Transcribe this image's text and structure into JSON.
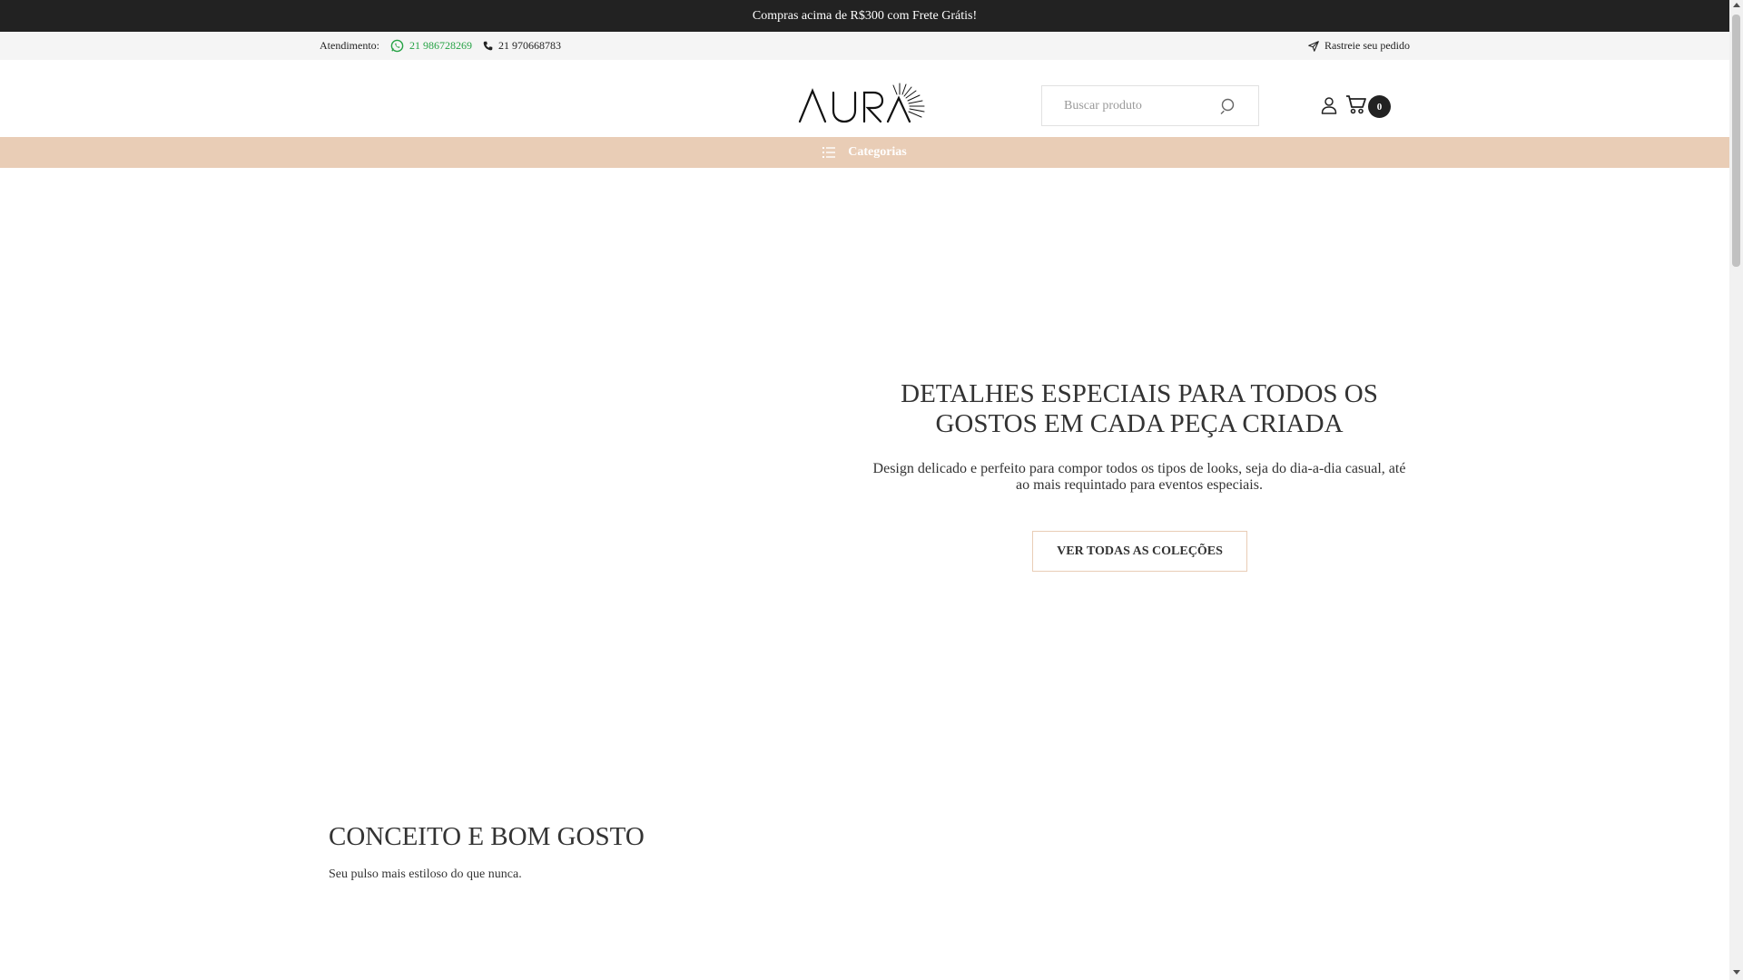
{
  "promo": {
    "text": "Compras acima de R$300 com Frete Grátis!"
  },
  "contact": {
    "label": "Atendimento:",
    "whatsapp": "21 986728269",
    "phone": "21 970668783",
    "track_order": "Rastreie seu pedido",
    "whatsapp_color": "#25a244"
  },
  "header": {
    "logo_text": "AURA",
    "search_placeholder": "Buscar produto",
    "cart_count": "0"
  },
  "nav": {
    "categories_label": "Categorias",
    "bar_color": "#e9cdb6"
  },
  "hero": {
    "title": "DETALHES ESPECIAIS PARA TODOS OS GOSTOS EM CADA PEÇA CRIADA",
    "description": "Design delicado e perfeito para compor todos os tipos de looks, seja do dia-a-dia casual, até ao mais requintado para eventos especiais.",
    "cta_label": "VER TODAS AS COLEÇÕES"
  },
  "concept": {
    "title": "CONCEITO E BOM GOSTO",
    "subtitle": "Seu pulso mais estiloso do que nunca."
  },
  "icons": [
    "whatsapp-icon",
    "phone-icon",
    "send-icon",
    "search-icon",
    "user-icon",
    "cart-icon",
    "list-icon"
  ]
}
